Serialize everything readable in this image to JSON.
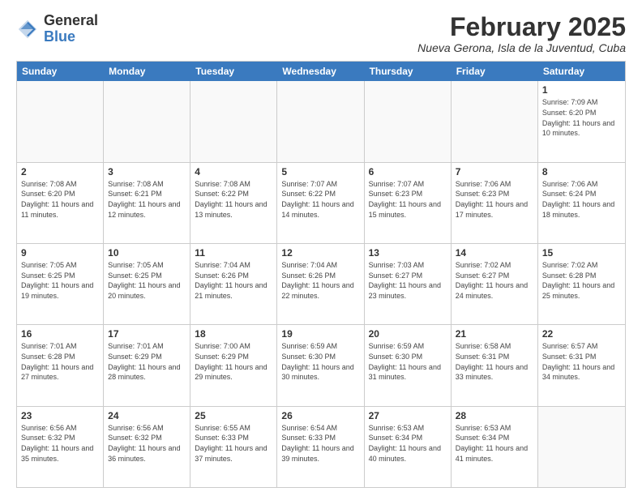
{
  "logo": {
    "general": "General",
    "blue": "Blue"
  },
  "title": "February 2025",
  "subtitle": "Nueva Gerona, Isla de la Juventud, Cuba",
  "weekdays": [
    "Sunday",
    "Monday",
    "Tuesday",
    "Wednesday",
    "Thursday",
    "Friday",
    "Saturday"
  ],
  "weeks": [
    [
      {
        "day": "",
        "info": ""
      },
      {
        "day": "",
        "info": ""
      },
      {
        "day": "",
        "info": ""
      },
      {
        "day": "",
        "info": ""
      },
      {
        "day": "",
        "info": ""
      },
      {
        "day": "",
        "info": ""
      },
      {
        "day": "1",
        "info": "Sunrise: 7:09 AM\nSunset: 6:20 PM\nDaylight: 11 hours\nand 10 minutes."
      }
    ],
    [
      {
        "day": "2",
        "info": "Sunrise: 7:08 AM\nSunset: 6:20 PM\nDaylight: 11 hours\nand 11 minutes."
      },
      {
        "day": "3",
        "info": "Sunrise: 7:08 AM\nSunset: 6:21 PM\nDaylight: 11 hours\nand 12 minutes."
      },
      {
        "day": "4",
        "info": "Sunrise: 7:08 AM\nSunset: 6:22 PM\nDaylight: 11 hours\nand 13 minutes."
      },
      {
        "day": "5",
        "info": "Sunrise: 7:07 AM\nSunset: 6:22 PM\nDaylight: 11 hours\nand 14 minutes."
      },
      {
        "day": "6",
        "info": "Sunrise: 7:07 AM\nSunset: 6:23 PM\nDaylight: 11 hours\nand 15 minutes."
      },
      {
        "day": "7",
        "info": "Sunrise: 7:06 AM\nSunset: 6:23 PM\nDaylight: 11 hours\nand 17 minutes."
      },
      {
        "day": "8",
        "info": "Sunrise: 7:06 AM\nSunset: 6:24 PM\nDaylight: 11 hours\nand 18 minutes."
      }
    ],
    [
      {
        "day": "9",
        "info": "Sunrise: 7:05 AM\nSunset: 6:25 PM\nDaylight: 11 hours\nand 19 minutes."
      },
      {
        "day": "10",
        "info": "Sunrise: 7:05 AM\nSunset: 6:25 PM\nDaylight: 11 hours\nand 20 minutes."
      },
      {
        "day": "11",
        "info": "Sunrise: 7:04 AM\nSunset: 6:26 PM\nDaylight: 11 hours\nand 21 minutes."
      },
      {
        "day": "12",
        "info": "Sunrise: 7:04 AM\nSunset: 6:26 PM\nDaylight: 11 hours\nand 22 minutes."
      },
      {
        "day": "13",
        "info": "Sunrise: 7:03 AM\nSunset: 6:27 PM\nDaylight: 11 hours\nand 23 minutes."
      },
      {
        "day": "14",
        "info": "Sunrise: 7:02 AM\nSunset: 6:27 PM\nDaylight: 11 hours\nand 24 minutes."
      },
      {
        "day": "15",
        "info": "Sunrise: 7:02 AM\nSunset: 6:28 PM\nDaylight: 11 hours\nand 25 minutes."
      }
    ],
    [
      {
        "day": "16",
        "info": "Sunrise: 7:01 AM\nSunset: 6:28 PM\nDaylight: 11 hours\nand 27 minutes."
      },
      {
        "day": "17",
        "info": "Sunrise: 7:01 AM\nSunset: 6:29 PM\nDaylight: 11 hours\nand 28 minutes."
      },
      {
        "day": "18",
        "info": "Sunrise: 7:00 AM\nSunset: 6:29 PM\nDaylight: 11 hours\nand 29 minutes."
      },
      {
        "day": "19",
        "info": "Sunrise: 6:59 AM\nSunset: 6:30 PM\nDaylight: 11 hours\nand 30 minutes."
      },
      {
        "day": "20",
        "info": "Sunrise: 6:59 AM\nSunset: 6:30 PM\nDaylight: 11 hours\nand 31 minutes."
      },
      {
        "day": "21",
        "info": "Sunrise: 6:58 AM\nSunset: 6:31 PM\nDaylight: 11 hours\nand 33 minutes."
      },
      {
        "day": "22",
        "info": "Sunrise: 6:57 AM\nSunset: 6:31 PM\nDaylight: 11 hours\nand 34 minutes."
      }
    ],
    [
      {
        "day": "23",
        "info": "Sunrise: 6:56 AM\nSunset: 6:32 PM\nDaylight: 11 hours\nand 35 minutes."
      },
      {
        "day": "24",
        "info": "Sunrise: 6:56 AM\nSunset: 6:32 PM\nDaylight: 11 hours\nand 36 minutes."
      },
      {
        "day": "25",
        "info": "Sunrise: 6:55 AM\nSunset: 6:33 PM\nDaylight: 11 hours\nand 37 minutes."
      },
      {
        "day": "26",
        "info": "Sunrise: 6:54 AM\nSunset: 6:33 PM\nDaylight: 11 hours\nand 39 minutes."
      },
      {
        "day": "27",
        "info": "Sunrise: 6:53 AM\nSunset: 6:34 PM\nDaylight: 11 hours\nand 40 minutes."
      },
      {
        "day": "28",
        "info": "Sunrise: 6:53 AM\nSunset: 6:34 PM\nDaylight: 11 hours\nand 41 minutes."
      },
      {
        "day": "",
        "info": ""
      }
    ]
  ]
}
